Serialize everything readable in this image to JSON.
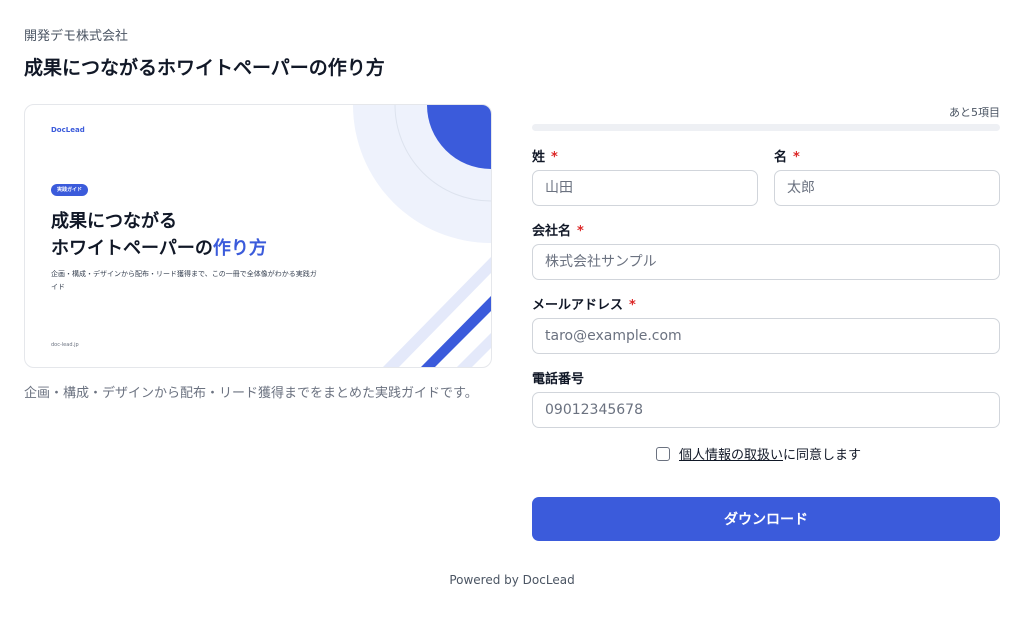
{
  "header": {
    "company": "開発デモ株式会社",
    "title": "成果につながるホワイトペーパーの作り方"
  },
  "cover": {
    "brand": "DocLead",
    "badge": "実践ガイド",
    "title_line1": "成果につながる",
    "title_line2_plain": "ホワイトペーパーの",
    "title_line2_accent": "作り方",
    "description": "企画・構成・デザインから配布・リード獲得まで、この一冊で全体像がわかる実践ガイド",
    "domain": "doc-lead.jp",
    "accent_color": "#3b5bdb"
  },
  "left_description": "企画・構成・デザインから配布・リード獲得までをまとめた実践ガイドです。",
  "form": {
    "remaining": "あと5項目",
    "progress_percent": 0,
    "fields": {
      "last_name": {
        "label": "姓",
        "required_mark": "*",
        "placeholder": "山田"
      },
      "first_name": {
        "label": "名",
        "required_mark": "*",
        "placeholder": "太郎"
      },
      "company": {
        "label": "会社名",
        "required_mark": "*",
        "placeholder": "株式会社サンプル"
      },
      "email": {
        "label": "メールアドレス",
        "required_mark": "*",
        "placeholder": "taro@example.com"
      },
      "phone": {
        "label": "電話番号",
        "placeholder": "09012345678"
      }
    },
    "consent": {
      "link_text": "個人情報の取扱い",
      "text": "に同意します",
      "checked": false
    },
    "submit_label": "ダウンロード"
  },
  "footer": "Powered by DocLead"
}
